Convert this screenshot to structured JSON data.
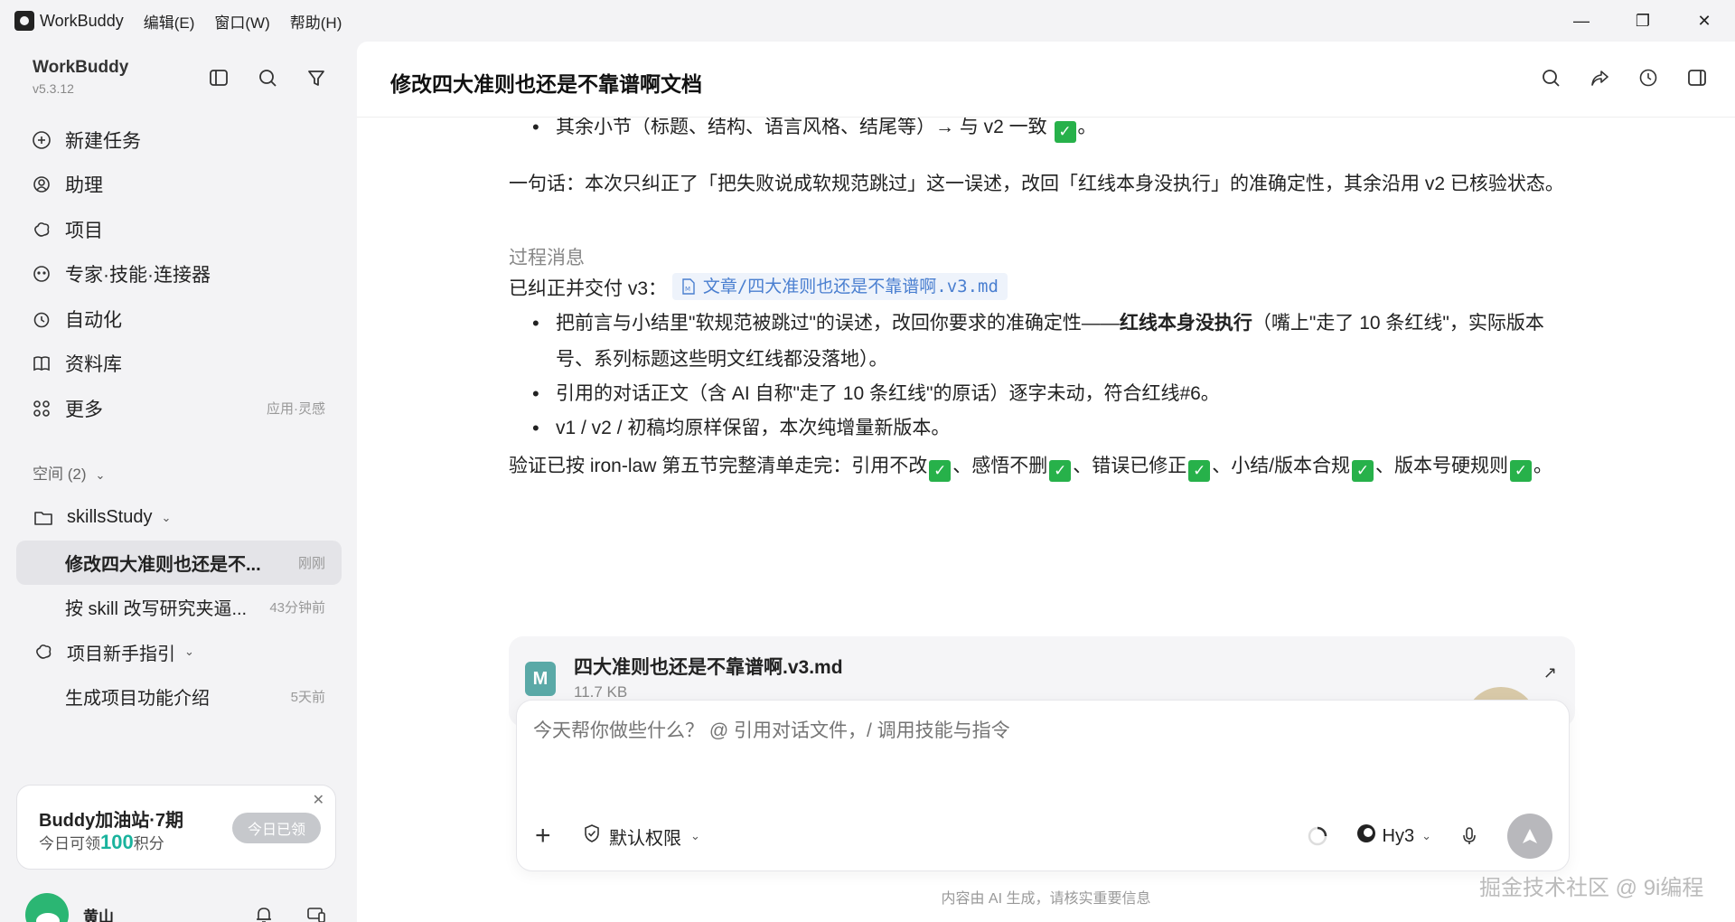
{
  "titlebar": {
    "app_name": "WorkBuddy",
    "menus": [
      "编辑(E)",
      "窗口(W)",
      "帮助(H)"
    ],
    "controls": [
      "—",
      "❐",
      "✕"
    ]
  },
  "sidebar": {
    "brand_name": "WorkBuddy",
    "version": "v5.3.12",
    "nav": [
      {
        "label": "新建任务",
        "icon": "new-task-icon"
      },
      {
        "label": "助理",
        "icon": "assistant-icon"
      },
      {
        "label": "项目",
        "icon": "project-icon"
      },
      {
        "label": "专家·技能·连接器",
        "icon": "expert-icon"
      },
      {
        "label": "自动化",
        "icon": "alarm-clock-icon"
      },
      {
        "label": "资料库",
        "icon": "book-icon"
      },
      {
        "label": "更多",
        "icon": "grid-icon",
        "sub": "应用·灵感"
      }
    ],
    "space_label": "空间 (2)",
    "tree": {
      "folder1": "skillsStudy",
      "item1": {
        "label": "修改四大准则也还是不...",
        "time": "刚刚"
      },
      "item2": {
        "label": "按 skill 改写研究夹逼...",
        "time": "43分钟前"
      },
      "folder2": "项目新手指引",
      "item3": {
        "label": "生成项目功能介绍",
        "time": "5天前"
      }
    },
    "promo": {
      "title": "Buddy加油站·7期",
      "sub_prefix": "今日可领",
      "points": "100",
      "sub_suffix": "积分",
      "button": "今日已领"
    },
    "user_name": "黄山"
  },
  "main": {
    "title": "修改四大准则也还是不靠谱啊文档",
    "line_top": "其余小节（标题、结构、语言风格、结尾等）→ 与 v2 一致",
    "summary": "一句话：本次只纠正了「把失败说成软规范跳过」这一误述，改回「红线本身没执行」的准确定性，其余沿用 v2 已核验状态。",
    "process_label": "过程消息",
    "delivered_prefix": "已纠正并交付 v3：",
    "file_link": "文章/四大准则也还是不靠谱啊.v3.md",
    "bullet1_a": "把前言与小结里\"软规范被跳过\"的误述，改回你要求的准确定性——",
    "bullet1_bold": "红线本身没执行",
    "bullet1_b": "（嘴上\"走了 10 条红线\"，实际版本号、系列标题这些明文红线都没落地）。",
    "bullet2": "引用的对话正文（含 AI 自称\"走了 10 条红线\"的原话）逐字未动，符合红线#6。",
    "bullet3": "v1 / v2 / 初稿均原样保留，本次纯增量新版本。",
    "verify_a": "验证已按 iron-law 第五节完整清单走完：引用不改",
    "verify_b": "、感悟不删",
    "verify_c": "、错误已修正",
    "verify_d": "、小结/版本合规",
    "verify_e": "、版本号硬规则",
    "verify_end": "。",
    "period": "。",
    "check_mark": "✓",
    "file_card": {
      "badge": "M",
      "name": "四大准则也还是不靠谱啊.v3.md",
      "size": "11.7 KB"
    },
    "composer": {
      "placeholder": "今天帮你做些什么？ @ 引用对话文件，/ 调用技能与指令",
      "permission": "默认权限",
      "model": "Hy3"
    },
    "disclaimer": "内容由 AI 生成，请核实重要信息"
  },
  "watermark": "掘金技术社区 @ 9i编程"
}
